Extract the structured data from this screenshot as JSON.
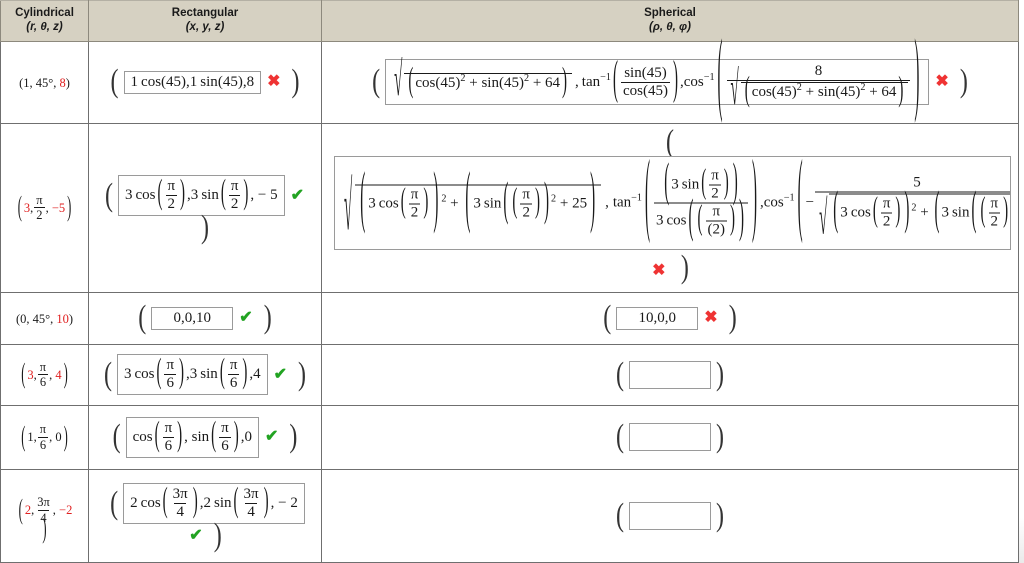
{
  "table": {
    "headers": [
      {
        "title": "Cylindrical",
        "vars": "(r, θ, z)"
      },
      {
        "title": "Rectangular",
        "vars": "(x, y, z)"
      },
      {
        "title": "Spherical",
        "vars": "(ρ, θ, φ)"
      }
    ],
    "rows": [
      {
        "id": "row-1",
        "cylindrical": {
          "text": "(1, 45°, 8)",
          "parts": [
            "1",
            "45°",
            "8"
          ],
          "red_index": 2,
          "style": "plain"
        },
        "rectangular": {
          "value": "1 cos(45),1 sin(45),8",
          "status": "incorrect",
          "status_mark": "✖",
          "empty": false
        },
        "spherical": {
          "value": "√(cos(45)² + sin(45)² + 64) , tan⁻¹(sin(45)/cos(45)), cos⁻¹(8/√(cos(45)² + sin(45)² + 64))",
          "status": "incorrect",
          "status_mark": "✖",
          "empty": false,
          "rho_inner": "cos(45)² + sin(45)² + 64",
          "theta_num": "sin(45)",
          "theta_den": "cos(45)",
          "phi_num": "8",
          "phi_den": "√(cos(45)² + sin(45)² + 64)"
        }
      },
      {
        "id": "row-2",
        "cylindrical": {
          "text": "(3, π/2, −5)",
          "r": "3",
          "theta_num": "π",
          "theta_den": "2",
          "z": "−5",
          "style": "frac"
        },
        "rectangular": {
          "value": "3 cos(π/2),3 sin(π/2), − 5",
          "status": "correct",
          "status_mark": "✔",
          "empty": false
        },
        "spherical": {
          "status": "incorrect",
          "status_mark": "✖",
          "empty": false,
          "clipped": true
        }
      },
      {
        "id": "row-3",
        "cylindrical": {
          "text": "(0, 45°, 10)",
          "parts": [
            "0",
            "45°",
            "10"
          ],
          "red_index": 2,
          "style": "plain"
        },
        "rectangular": {
          "value": "0,0,10",
          "status": "correct",
          "status_mark": "✔",
          "empty": false
        },
        "spherical": {
          "value": "10,0,0",
          "status": "incorrect",
          "status_mark": "✖",
          "empty": false
        }
      },
      {
        "id": "row-4",
        "cylindrical": {
          "text": "(3, π/6, 4)",
          "r": "3",
          "theta_num": "π",
          "theta_den": "6",
          "z": "4",
          "style": "frac",
          "r_red": true,
          "z_red": true
        },
        "rectangular": {
          "value": "3 cos(π/6),3 sin(π/6),4",
          "status": "correct",
          "status_mark": "✔",
          "empty": false
        },
        "spherical": {
          "value": "",
          "status": "none",
          "status_mark": "",
          "empty": true
        }
      },
      {
        "id": "row-5",
        "cylindrical": {
          "text": "(1, π/6, 0)",
          "r": "1",
          "theta_num": "π",
          "theta_den": "6",
          "z": "0",
          "style": "frac",
          "r_red": false,
          "z_red": false
        },
        "rectangular": {
          "value": "cos(π/6), sin(π/6),0",
          "status": "correct",
          "status_mark": "✔",
          "empty": false
        },
        "spherical": {
          "value": "",
          "status": "none",
          "status_mark": "",
          "empty": true
        }
      },
      {
        "id": "row-6",
        "cylindrical": {
          "text": "(2, 3π/4, −2)",
          "r": "2",
          "theta_num": "3π",
          "theta_den": "4",
          "z": "−2",
          "style": "frac",
          "r_red": true,
          "z_red": true
        },
        "rectangular": {
          "value": "2 cos(3π/4),2 sin(3π/4), − 2",
          "status": "correct",
          "status_mark": "✔",
          "empty": false
        },
        "spherical": {
          "value": "",
          "status": "none",
          "status_mark": "",
          "empty": true
        }
      }
    ]
  },
  "glyphs": {
    "open_paren": "(",
    "close_paren": ")",
    "comma": ",",
    "check": "✔",
    "cross": "✖",
    "radical": "√",
    "pi": "π",
    "minus": "−",
    "plus": "+",
    "cos": "cos",
    "sin": "sin",
    "tan": "tan",
    "inv": "−1"
  },
  "literals": {
    "n1": "1",
    "n2": "2",
    "n3": "3",
    "n4": "4",
    "n5": "5",
    "n8": "8",
    "n10": "10",
    "n25": "25",
    "n64": "64",
    "n45": "45",
    "n0": "0",
    "neg5": "− 5",
    "neg2": "− 2",
    "exp2": "2"
  },
  "colors": {
    "header_bg": "#d6d1c2",
    "border": "#6f6f6f",
    "correct": "#22a322",
    "incorrect": "#ef3333",
    "red_value": "#e02020",
    "box_border": "#9a9a9a"
  }
}
